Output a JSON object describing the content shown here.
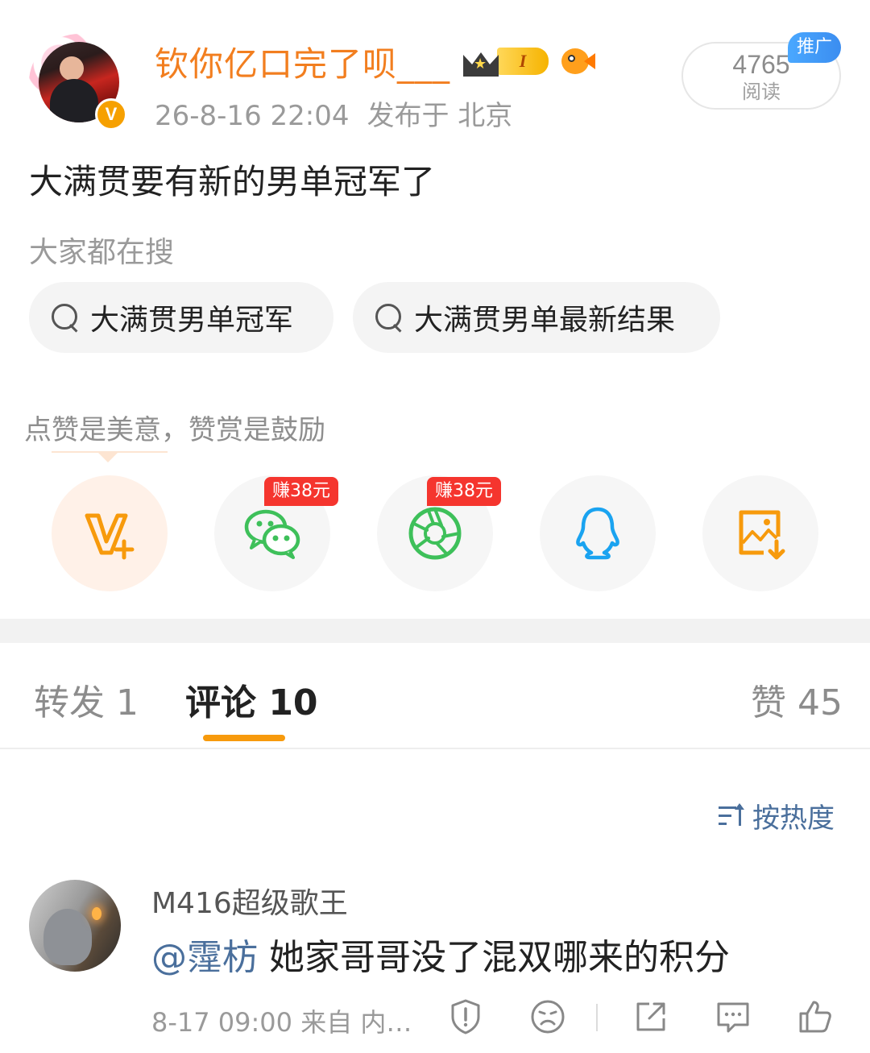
{
  "post": {
    "username": "钦你亿口完了呗___",
    "level": "I",
    "time": "26-8-16 22:04",
    "location": "发布于 北京",
    "reads_count": "4765",
    "reads_label": "阅读",
    "promo_label": "推广",
    "text": "大满贯要有新的男单冠军了"
  },
  "search": {
    "hint": "大家都在搜",
    "chips": [
      "大满贯男单冠军",
      "大满贯男单最新结果"
    ]
  },
  "reward": {
    "hint": "点赞是美意，赞赏是鼓励",
    "earn_tags": [
      "赚38元",
      "赚38元"
    ]
  },
  "tabs": {
    "repost": "转发 1",
    "comments": "评论 10",
    "likes": "赞 45"
  },
  "sort_label": "按热度",
  "comment": {
    "user": "M416超级歌王",
    "mention": "@霪枋",
    "text": " 她家哥哥没了混双哪来的积分",
    "time": "8-17 09:00  来自 内…"
  },
  "colors": {
    "accent": "#f79a0c",
    "username": "#f27e1f",
    "link": "#4a6f9c",
    "earn_tag": "#f5352e",
    "wechat": "#3ec05a",
    "qq": "#1aa3f0"
  },
  "icons": [
    "search-icon",
    "reward-icon",
    "wechat-icon",
    "moments-icon",
    "qq-icon",
    "save-image-icon",
    "sort-icon",
    "report-icon",
    "dislike-icon",
    "share-icon",
    "comment-icon",
    "like-icon"
  ]
}
